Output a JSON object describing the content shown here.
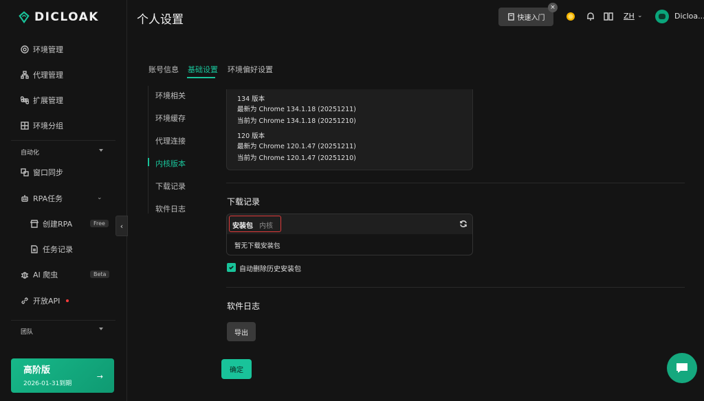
{
  "brand": {
    "name": "DICLOAK"
  },
  "sidebar": {
    "items": [
      {
        "label": "环境管理",
        "icon": "chrome-icon"
      },
      {
        "label": "代理管理",
        "icon": "network-icon"
      },
      {
        "label": "扩展管理",
        "icon": "command-icon"
      },
      {
        "label": "环境分组",
        "icon": "group-icon"
      }
    ],
    "automation": {
      "section": "自动化",
      "window_sync": "窗口同步",
      "rpa": "RPA任务",
      "create_rpa": "创建RPA",
      "create_rpa_tag": "Free",
      "task_log": "任务记录",
      "ai_crawler": "AI 爬虫",
      "ai_crawler_tag": "Beta",
      "open_api": "开放API"
    },
    "team_section": "团队",
    "plan": {
      "title": "高阶版",
      "expiry": "2026-01-31到期"
    }
  },
  "header": {
    "title": "个人设置",
    "quickstart": "快速入门",
    "close": "×",
    "language": "ZH",
    "user": "Dicloa..."
  },
  "tabs": [
    "账号信息",
    "基础设置",
    "环境偏好设置"
  ],
  "subnav": [
    "环境相关",
    "环境缓存",
    "代理连接",
    "内核版本",
    "下载记录",
    "软件日志"
  ],
  "kernel": {
    "lines_134": [
      "134 版本",
      "最新为 Chrome 134.1.18 (20251211)",
      "当前为 Chrome 134.1.18 (20251210)"
    ],
    "lines_120": [
      "120 版本",
      "最新为 Chrome 120.1.47 (20251211)",
      "当前为 Chrome 120.1.47 (20251210)"
    ]
  },
  "download": {
    "title": "下载记录",
    "tab_installer": "安装包",
    "tab_kernel": "内核",
    "empty": "暂无下载安装包",
    "auto_delete": "自动删除历史安装包"
  },
  "logs": {
    "title": "软件日志",
    "export": "导出"
  },
  "confirm": "确定",
  "colors": {
    "accent": "#19c39a",
    "highlight": "#e23b3b"
  }
}
